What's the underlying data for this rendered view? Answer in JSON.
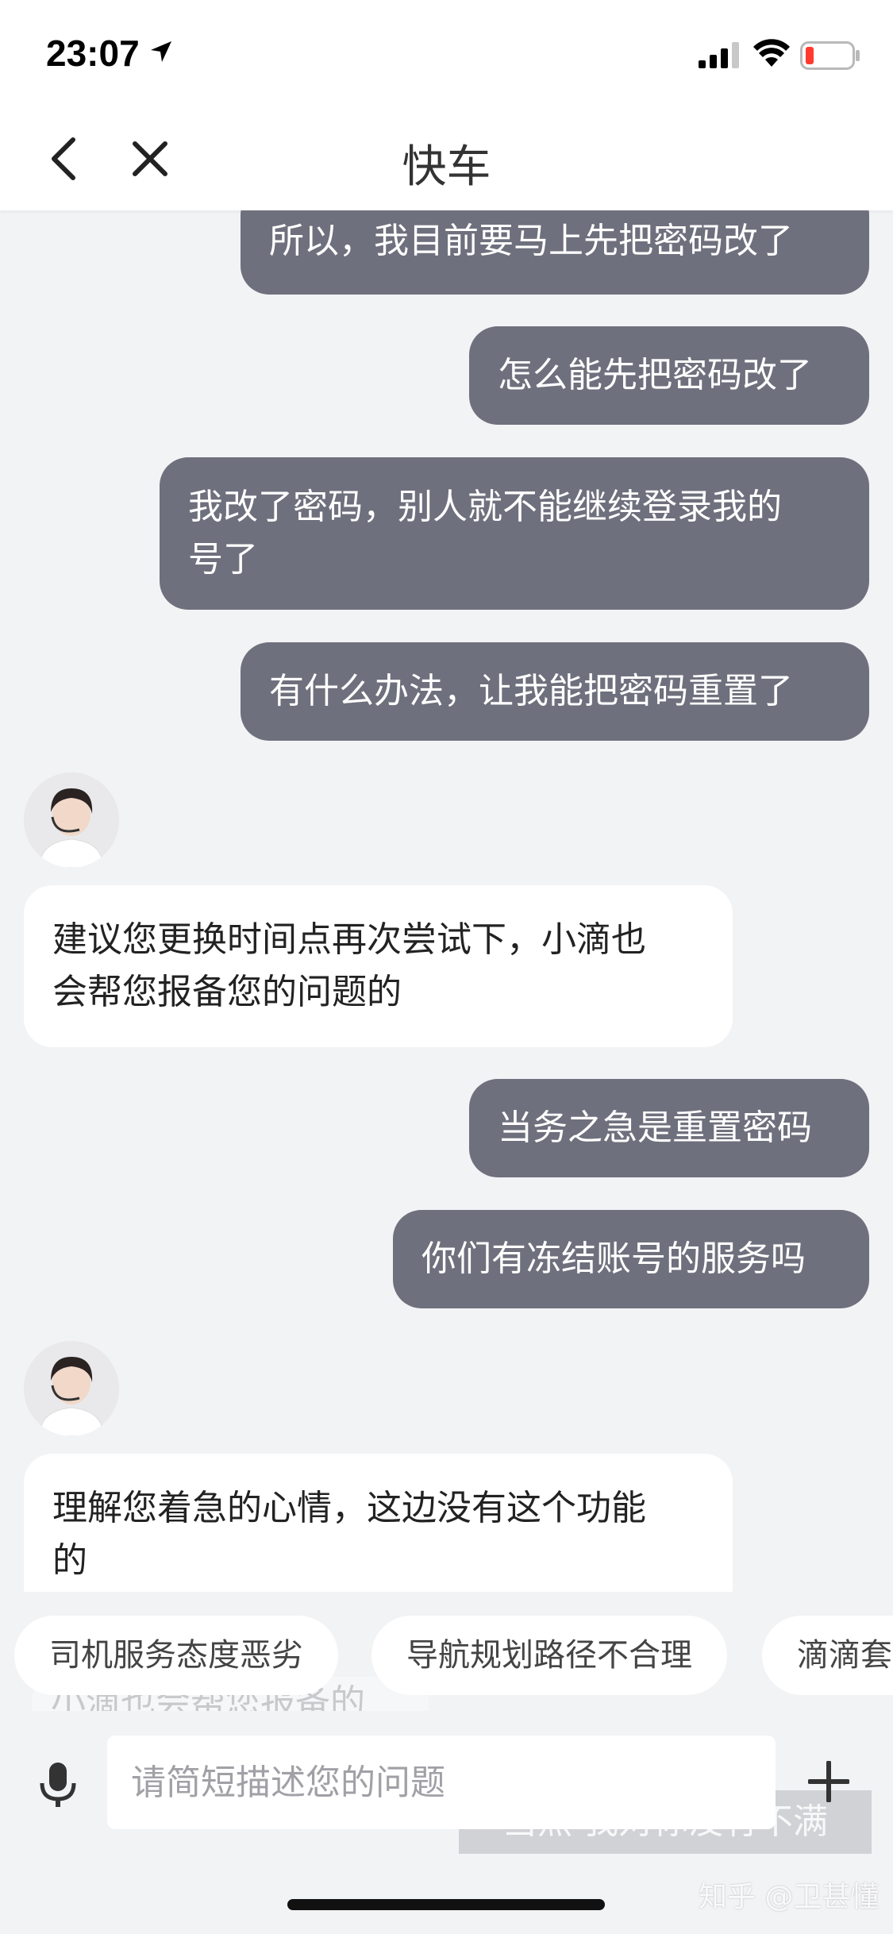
{
  "status_bar": {
    "time": "23:07"
  },
  "nav": {
    "title": "快车"
  },
  "messages": [
    {
      "side": "out",
      "lines": [
        "所以，我目前要马上先把密码改了"
      ]
    },
    {
      "side": "out",
      "lines": [
        "怎么能先把密码改了"
      ]
    },
    {
      "side": "out",
      "lines": [
        "我改了密码，别人就不能继续登录我的",
        "号了"
      ]
    },
    {
      "side": "out",
      "lines": [
        "有什么办法，让我能把密码重置了"
      ]
    },
    {
      "side": "in",
      "lines": [
        "建议您更换时间点再次尝试下，小滴也",
        "会帮您报备您的问题的"
      ]
    },
    {
      "side": "out",
      "lines": [
        "当务之急是重置密码"
      ]
    },
    {
      "side": "out",
      "lines": [
        "你们有冻结账号的服务吗"
      ]
    },
    {
      "side": "in",
      "lines": [
        "理解您着急的心情，这边没有这个功能",
        "的"
      ]
    }
  ],
  "ghost": {
    "in_text": "小滴也会帮您报备的",
    "out_text": "当然 我对你没有不满"
  },
  "quick_replies": [
    "司机服务态度恶劣",
    "导航规划路径不合理",
    "滴滴套"
  ],
  "input": {
    "placeholder": "请简短描述您的问题",
    "value": ""
  },
  "watermark": "知乎 @卫甚懂",
  "colors": {
    "outgoing_bubble": "#6f707d",
    "incoming_bubble": "#ffffff",
    "background": "#f2f3f5"
  }
}
